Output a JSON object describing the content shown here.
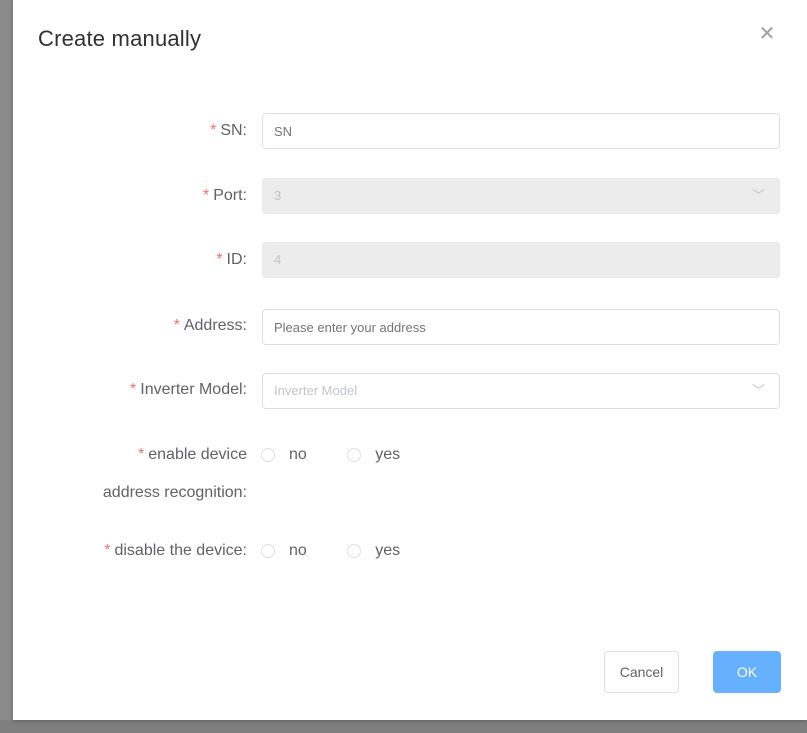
{
  "dialog": {
    "title": "Create manually",
    "close_icon": "close-icon"
  },
  "fields": {
    "sn": {
      "label": "SN:",
      "placeholder": "SN",
      "value": ""
    },
    "port": {
      "label": "Port:",
      "value": "3"
    },
    "id": {
      "label": "ID:",
      "value": "4"
    },
    "address": {
      "label": "Address:",
      "placeholder": "Please enter your address",
      "value": ""
    },
    "inverter_model": {
      "label": "Inverter Model:",
      "placeholder": "Inverter Model",
      "value": ""
    },
    "address_recognition": {
      "label_line1": "enable device",
      "label_line2": "address recognition:",
      "options": [
        "no",
        "yes"
      ]
    },
    "disable_device": {
      "label": "disable the device:",
      "options": [
        "no",
        "yes"
      ]
    }
  },
  "required_mark": "*",
  "buttons": {
    "cancel": "Cancel",
    "ok": "OK"
  },
  "colors": {
    "primary": "#66b1ff",
    "required": "#f56c6c"
  }
}
